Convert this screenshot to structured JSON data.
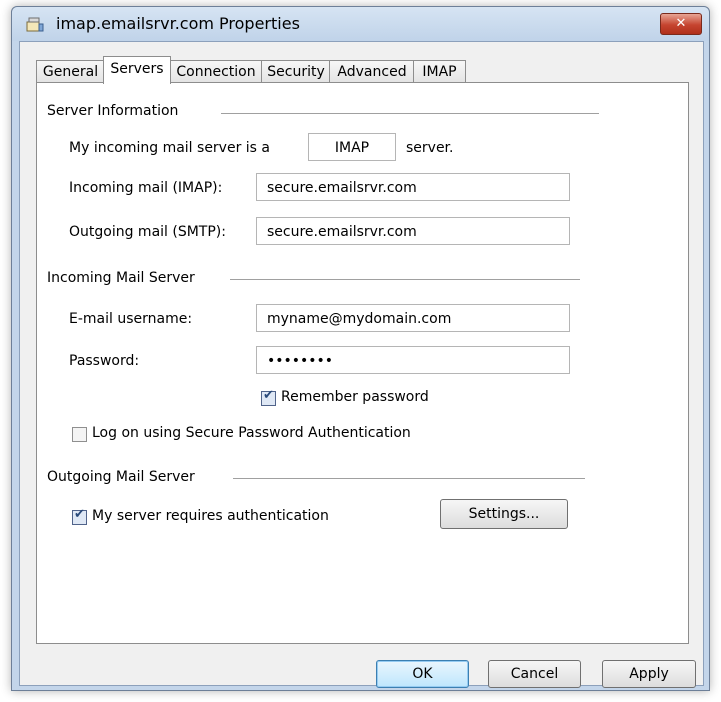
{
  "window": {
    "title": "imap.emailsrvr.com Properties",
    "close_symbol": "✕"
  },
  "tabs": [
    "General",
    "Servers",
    "Connection",
    "Security",
    "Advanced",
    "IMAP"
  ],
  "active_tab": "Servers",
  "server_info": {
    "group_title": "Server Information",
    "server_type_prefix": "My incoming mail server is a",
    "server_type_value": "IMAP",
    "server_type_suffix": "server.",
    "incoming_label": "Incoming mail (IMAP):",
    "incoming_value": "secure.emailsrvr.com",
    "outgoing_label": "Outgoing mail (SMTP):",
    "outgoing_value": "secure.emailsrvr.com"
  },
  "incoming_server": {
    "group_title": "Incoming Mail Server",
    "username_label": "E-mail username:",
    "username_value": "myname@mydomain.com",
    "password_label": "Password:",
    "password_value": "••••••••",
    "remember_label": "Remember password",
    "remember_checked": true,
    "spa_label": "Log on using Secure Password Authentication",
    "spa_checked": false
  },
  "outgoing_server": {
    "group_title": "Outgoing Mail Server",
    "auth_label": "My server requires authentication",
    "auth_checked": true,
    "settings_label": "Settings..."
  },
  "buttons": {
    "ok": "OK",
    "cancel": "Cancel",
    "apply": "Apply"
  }
}
